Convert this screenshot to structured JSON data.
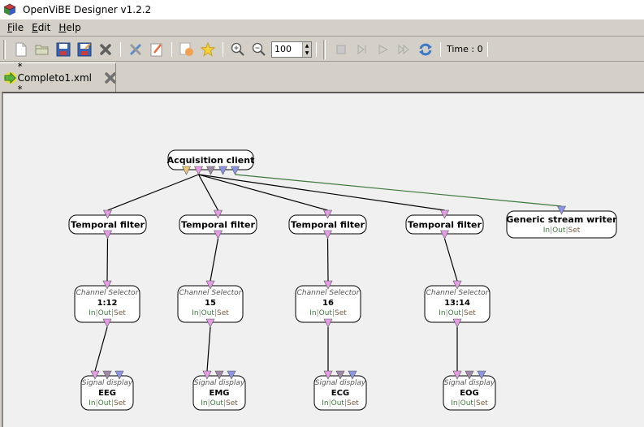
{
  "window": {
    "title": "OpenViBE Designer v1.2.2",
    "icon": "openvibe-cube-icon"
  },
  "menu": [
    {
      "label": "File",
      "mnemonic": "F",
      "rest": "ile"
    },
    {
      "label": "Edit",
      "mnemonic": "E",
      "rest": "dit"
    },
    {
      "label": "Help",
      "mnemonic": "H",
      "rest": "elp"
    }
  ],
  "toolbar": {
    "buttons": [
      {
        "name": "new-file",
        "icon": "new-file-icon"
      },
      {
        "name": "open-file",
        "icon": "open-folder-icon"
      },
      {
        "name": "save",
        "icon": "save-icon"
      },
      {
        "name": "save-as",
        "icon": "save-as-icon"
      },
      {
        "name": "close",
        "icon": "close-x-icon"
      },
      {
        "name": "settings",
        "icon": "tools-icon"
      },
      {
        "name": "edit-scenario",
        "icon": "edit-pencil-icon"
      },
      {
        "name": "hand-tool",
        "icon": "hand-document-icon"
      },
      {
        "name": "favorite",
        "icon": "star-icon"
      },
      {
        "name": "zoom-in",
        "icon": "zoom-in-icon"
      },
      {
        "name": "zoom-out",
        "icon": "zoom-out-icon"
      },
      {
        "name": "stop",
        "icon": "stop-icon"
      },
      {
        "name": "step",
        "icon": "step-icon"
      },
      {
        "name": "play",
        "icon": "play-icon"
      },
      {
        "name": "fast-forward",
        "icon": "fast-forward-icon"
      },
      {
        "name": "refresh",
        "icon": "refresh-icon"
      }
    ],
    "zoom_value": "100",
    "time_label": "Time : 0"
  },
  "tabs": [
    {
      "label": "* Completo1.xml *",
      "icon": "scenario-arrow-icon",
      "close_icon": "close-x-icon"
    }
  ],
  "scenario": {
    "io_labels": {
      "in": "In",
      "out": "Out",
      "set": "Set",
      "sep": "|"
    },
    "nodes": [
      {
        "id": "acq",
        "type": "Acquisition client",
        "name": "",
        "kind": "simple"
      },
      {
        "id": "tf1",
        "type": "Temporal filter",
        "name": "",
        "kind": "simple"
      },
      {
        "id": "tf2",
        "type": "Temporal filter",
        "name": "",
        "kind": "simple"
      },
      {
        "id": "tf3",
        "type": "Temporal filter",
        "name": "",
        "kind": "simple"
      },
      {
        "id": "tf4",
        "type": "Temporal filter",
        "name": "",
        "kind": "simple"
      },
      {
        "id": "gsw",
        "type": "Generic stream writer",
        "name": "",
        "kind": "io"
      },
      {
        "id": "cs1",
        "type": "Channel Selector",
        "name": "1:12",
        "kind": "named"
      },
      {
        "id": "cs2",
        "type": "Channel Selector",
        "name": "15",
        "kind": "named"
      },
      {
        "id": "cs3",
        "type": "Channel Selector",
        "name": "16",
        "kind": "named"
      },
      {
        "id": "cs4",
        "type": "Channel Selector",
        "name": "13:14",
        "kind": "named"
      },
      {
        "id": "sd1",
        "type": "Signal display",
        "name": "EEG",
        "kind": "named"
      },
      {
        "id": "sd2",
        "type": "Signal display",
        "name": "EMG",
        "kind": "named"
      },
      {
        "id": "sd3",
        "type": "Signal display",
        "name": "ECG",
        "kind": "named"
      },
      {
        "id": "sd4",
        "type": "Signal display",
        "name": "EOG",
        "kind": "named"
      }
    ],
    "links": [
      {
        "from": "acq",
        "to": "tf1",
        "color": "#000000"
      },
      {
        "from": "acq",
        "to": "tf2",
        "color": "#000000"
      },
      {
        "from": "acq",
        "to": "tf3",
        "color": "#000000"
      },
      {
        "from": "acq",
        "to": "tf4",
        "color": "#000000"
      },
      {
        "from": "acq",
        "to": "gsw",
        "color": "#3c7a3c"
      },
      {
        "from": "tf1",
        "to": "cs1",
        "color": "#000000"
      },
      {
        "from": "tf2",
        "to": "cs2",
        "color": "#000000"
      },
      {
        "from": "tf3",
        "to": "cs3",
        "color": "#000000"
      },
      {
        "from": "tf4",
        "to": "cs4",
        "color": "#000000"
      },
      {
        "from": "cs1",
        "to": "sd1",
        "color": "#000000"
      },
      {
        "from": "cs2",
        "to": "sd2",
        "color": "#000000"
      },
      {
        "from": "cs3",
        "to": "sd3",
        "color": "#000000"
      },
      {
        "from": "cs4",
        "to": "sd4",
        "color": "#000000"
      }
    ],
    "colors": {
      "signal": "#e59be5",
      "stimulation": "#e6c878",
      "matrix": "#a08aa8",
      "stream": "#8c96e6",
      "in_text": "#3c7a3c",
      "out_text": "#3c7a3c",
      "set_text": "#7a5a3c"
    }
  }
}
